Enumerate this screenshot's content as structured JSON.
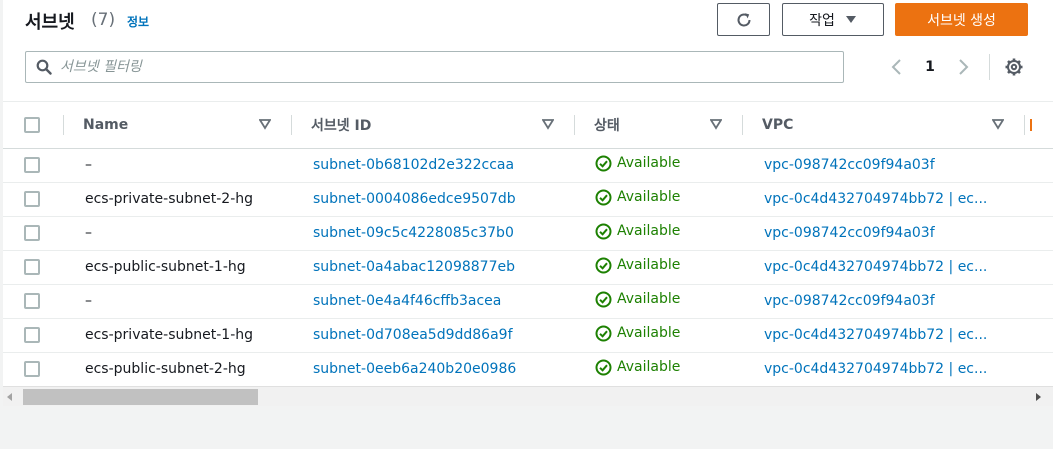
{
  "header": {
    "title": "서브넷",
    "count": "(7)",
    "info_link": "정보",
    "actions_label": "작업",
    "create_label": "서브넷 생성",
    "refresh_icon": "refresh-icon"
  },
  "search": {
    "placeholder": "서브넷 필터링",
    "value": ""
  },
  "pagination": {
    "current_page": "1"
  },
  "columns": [
    "Name",
    "서브넷 ID",
    "상태",
    "VPC"
  ],
  "rows": [
    {
      "name": "–",
      "subnet_id": "subnet-0b68102d2e322ccaa",
      "status": "Available",
      "vpc": "vpc-098742cc09f94a03f"
    },
    {
      "name": "ecs-private-subnet-2-hg",
      "subnet_id": "subnet-0004086edce9507db",
      "status": "Available",
      "vpc": "vpc-0c4d432704974bb72 | ec..."
    },
    {
      "name": "–",
      "subnet_id": "subnet-09c5c4228085c37b0",
      "status": "Available",
      "vpc": "vpc-098742cc09f94a03f"
    },
    {
      "name": "ecs-public-subnet-1-hg",
      "subnet_id": "subnet-0a4abac12098877eb",
      "status": "Available",
      "vpc": "vpc-0c4d432704974bb72 | ec..."
    },
    {
      "name": "–",
      "subnet_id": "subnet-0e4a4f46cffb3acea",
      "status": "Available",
      "vpc": "vpc-098742cc09f94a03f"
    },
    {
      "name": "ecs-private-subnet-1-hg",
      "subnet_id": "subnet-0d708ea5d9dd86a9f",
      "status": "Available",
      "vpc": "vpc-0c4d432704974bb72 | ec..."
    },
    {
      "name": "ecs-public-subnet-2-hg",
      "subnet_id": "subnet-0eeb6a240b20e0986",
      "status": "Available",
      "vpc": "vpc-0c4d432704974bb72 | ec..."
    }
  ],
  "colors": {
    "primary_button": "#ec7211",
    "link": "#0073bb",
    "status_ok": "#1d8102"
  }
}
